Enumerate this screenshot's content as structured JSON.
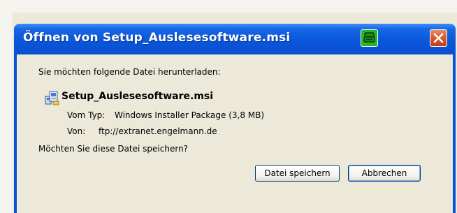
{
  "dialog": {
    "title": "Öffnen von Setup_Auslesesoftware.msi",
    "prompt": "Sie möchten folgende Datei herunterladen:",
    "file": {
      "name": "Setup_Auslesesoftware.msi",
      "type_label": "Vom Typ:",
      "type_value": "Windows Installer Package (3,8 MB)",
      "from_label": "Von:",
      "from_value": "ftp://extranet.engelmann.de"
    },
    "question": "Möchten Sie diese Datei speichern?",
    "buttons": {
      "save": "Datei speichern",
      "cancel": "Abbrechen"
    },
    "icons": {
      "app": "green-app-icon",
      "close": "close-icon",
      "file": "installer-package-icon"
    }
  }
}
